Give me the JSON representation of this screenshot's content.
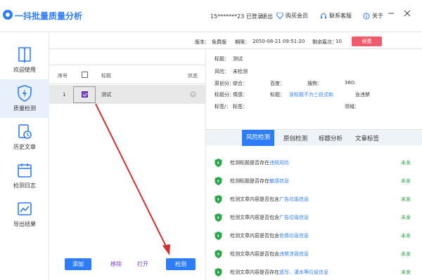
{
  "app": {
    "title": "一抖批量质量分析"
  },
  "titlebar": {
    "user": "15*******23 已登录",
    "logout": "退出",
    "buy": "购买会员",
    "service": "联系客服",
    "about": "关于"
  },
  "sidebar": {
    "items": [
      {
        "label": "欢迎使用",
        "icon": "book-icon"
      },
      {
        "label": "质量检测",
        "icon": "shield-bolt-icon"
      },
      {
        "label": "历史文章",
        "icon": "history-clock-icon"
      },
      {
        "label": "检测日志",
        "icon": "calendar-icon"
      },
      {
        "label": "导出结果",
        "icon": "export-chart-icon"
      }
    ]
  },
  "infobar": {
    "version_label": "版本：",
    "version": "免费版",
    "expire_label": "期限：",
    "expire": "2050-08-21 09:51:20",
    "remaining_label": "剩余篇次：",
    "remaining": "10",
    "renew": "续费"
  },
  "list": {
    "col_no": "序号",
    "col_title": "标题",
    "col_status": "状态",
    "rows": [
      {
        "no": "1",
        "title": "测试"
      }
    ],
    "add": "添加",
    "remove": "移除",
    "open": "打开",
    "detect": "检测"
  },
  "detail": {
    "title_label": "标题：",
    "title": "测试",
    "risk_label": "风险：",
    "risk": "未检测",
    "orig_label": "原创分：",
    "orig_composite": "综合：",
    "orig_baidu": "百度：",
    "orig_sogou": "搜狗：",
    "orig_360": "360:",
    "tag_label": "标题分：",
    "tag_emotion": "情感：",
    "tag_title": "标题：",
    "tag_title_hint": "该标题不为三段式和",
    "tag_contain": "含违禁",
    "label_label": "标签/：",
    "label_tags": "标签：",
    "label_domain": "领域："
  },
  "tabs": [
    "风险检测",
    "原创检测",
    "标题分析",
    "文章标签"
  ],
  "checks": [
    {
      "prefix": "检测标题是否存在",
      "hl": "违规风险",
      "result": "未发"
    },
    {
      "prefix": "检测标题是否存在",
      "hl": "敏感信息",
      "result": "未发"
    },
    {
      "prefix": "检测文章内容是否包含",
      "hl": "广告垃圾信息",
      "result": "未发"
    },
    {
      "prefix": "检测文章内容是否包含",
      "hl": "广告垃圾信息",
      "result": "未发"
    },
    {
      "prefix": "检测文章内容是否包含",
      "hl": "色情垃圾信息",
      "result": "未发"
    },
    {
      "prefix": "检测文章内容是否包含",
      "hl": "违禁涉政信息",
      "result": "未发"
    },
    {
      "prefix": "检测文章内容是否存在",
      "hl": "遗写、灌水等垃圾信息",
      "result": "未发"
    }
  ],
  "colors": {
    "accent": "#2d7df6",
    "renew": "#ef5b6c",
    "checked": "#7b3fc4",
    "ok": "#2aa84a",
    "arrow": "#d62f2f"
  }
}
